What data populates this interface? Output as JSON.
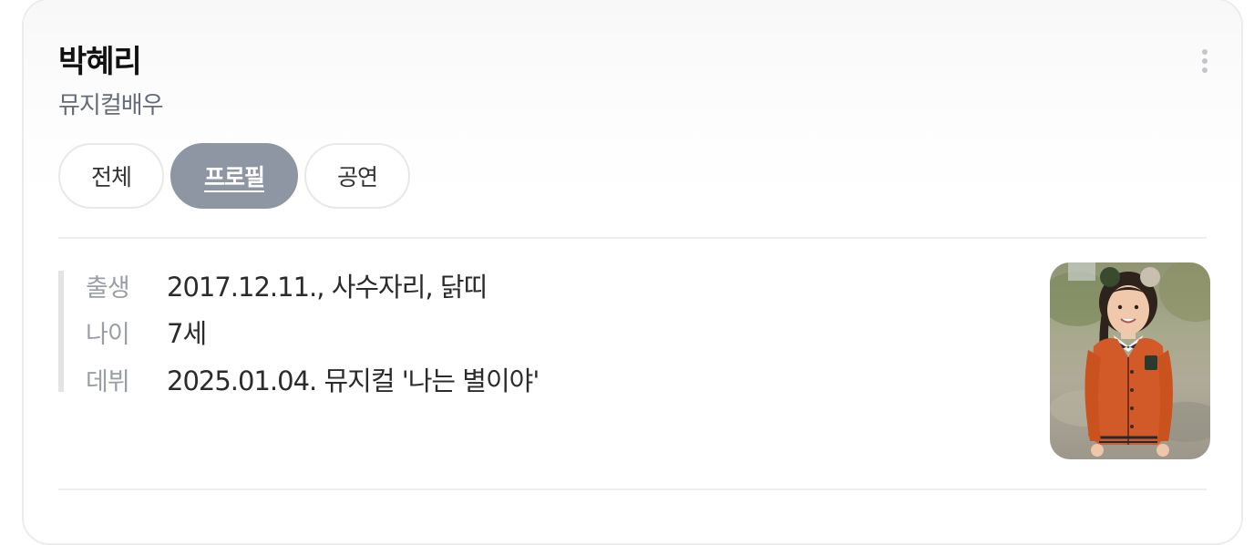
{
  "profile": {
    "name": "박혜리",
    "occupation": "뮤지컬배우"
  },
  "tabs": [
    {
      "label": "전체",
      "active": false
    },
    {
      "label": "프로필",
      "active": true
    },
    {
      "label": "공연",
      "active": false
    }
  ],
  "info": [
    {
      "label": "출생",
      "value": "2017.12.11., 사수자리, 닭띠"
    },
    {
      "label": "나이",
      "value": "7세"
    },
    {
      "label": "데뷔",
      "value": "2025.01.04. 뮤지컬 '나는 별이야'"
    }
  ],
  "icons": {
    "more": "more-vertical-icon",
    "photo": "child-actor-photo"
  },
  "colors": {
    "active_tab_bg": "#8e95a3",
    "label_text": "#9a9ea6",
    "subtitle_text": "#666b75"
  }
}
